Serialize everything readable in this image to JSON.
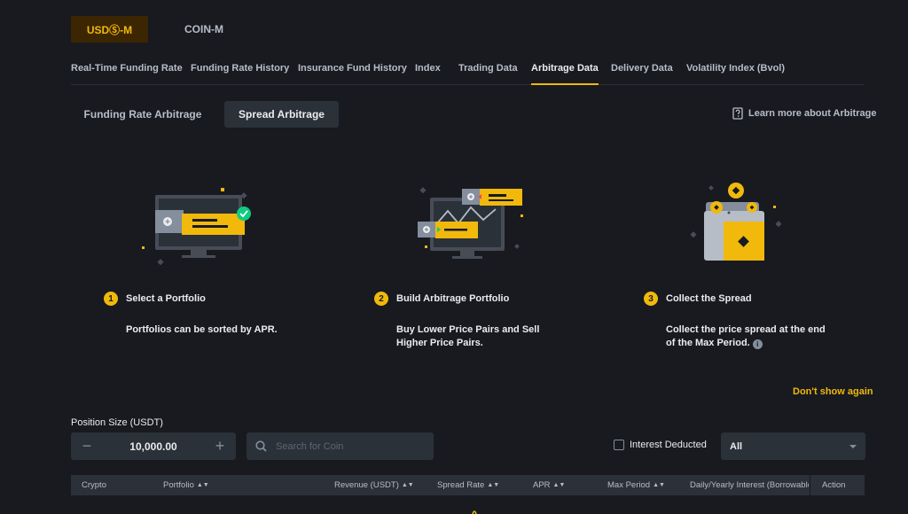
{
  "margin_toggle": {
    "usds_m": "USDⓈ-M",
    "coin_m": "COIN-M"
  },
  "nav_tabs": [
    "Real-Time Funding Rate",
    "Funding Rate History",
    "Insurance Fund History",
    "Index",
    "Trading Data",
    "Arbitrage Data",
    "Delivery Data",
    "Volatility Index (Bvol)"
  ],
  "nav_active": "Arbitrage Data",
  "sub_tabs": {
    "funding_rate_arbitrage": "Funding Rate Arbitrage",
    "spread_arbitrage": "Spread Arbitrage"
  },
  "learn_more": "Learn more about Arbitrage",
  "steps": [
    {
      "num": "1",
      "title": "Select a Portfolio",
      "desc": "Portfolios can be sorted by APR."
    },
    {
      "num": "2",
      "title": "Build Arbitrage Portfolio",
      "desc": "Buy Lower Price Pairs and Sell Higher Price Pairs."
    },
    {
      "num": "3",
      "title": "Collect the Spread",
      "desc": "Collect the price spread at the end of the Max Period."
    }
  ],
  "dont_show_again": "Don't show again",
  "position_size": {
    "label": "Position Size (USDT)",
    "value": "10,000.00",
    "minus": "−",
    "plus": "+"
  },
  "search": {
    "placeholder": "Search for Coin"
  },
  "interest_deducted": "Interest Deducted",
  "filter_select": {
    "value": "All"
  },
  "table_headers": {
    "crypto": "Crypto",
    "portfolio": "Portfolio",
    "revenue": "Revenue (USDT)",
    "spread_rate": "Spread Rate",
    "apr": "APR",
    "max_period": "Max Period",
    "interest": "Daily/Yearly Interest (Borrowable",
    "action": "Action"
  },
  "colors": {
    "accent": "#f0b90b",
    "background": "#181a20",
    "panel": "#2b3139"
  }
}
